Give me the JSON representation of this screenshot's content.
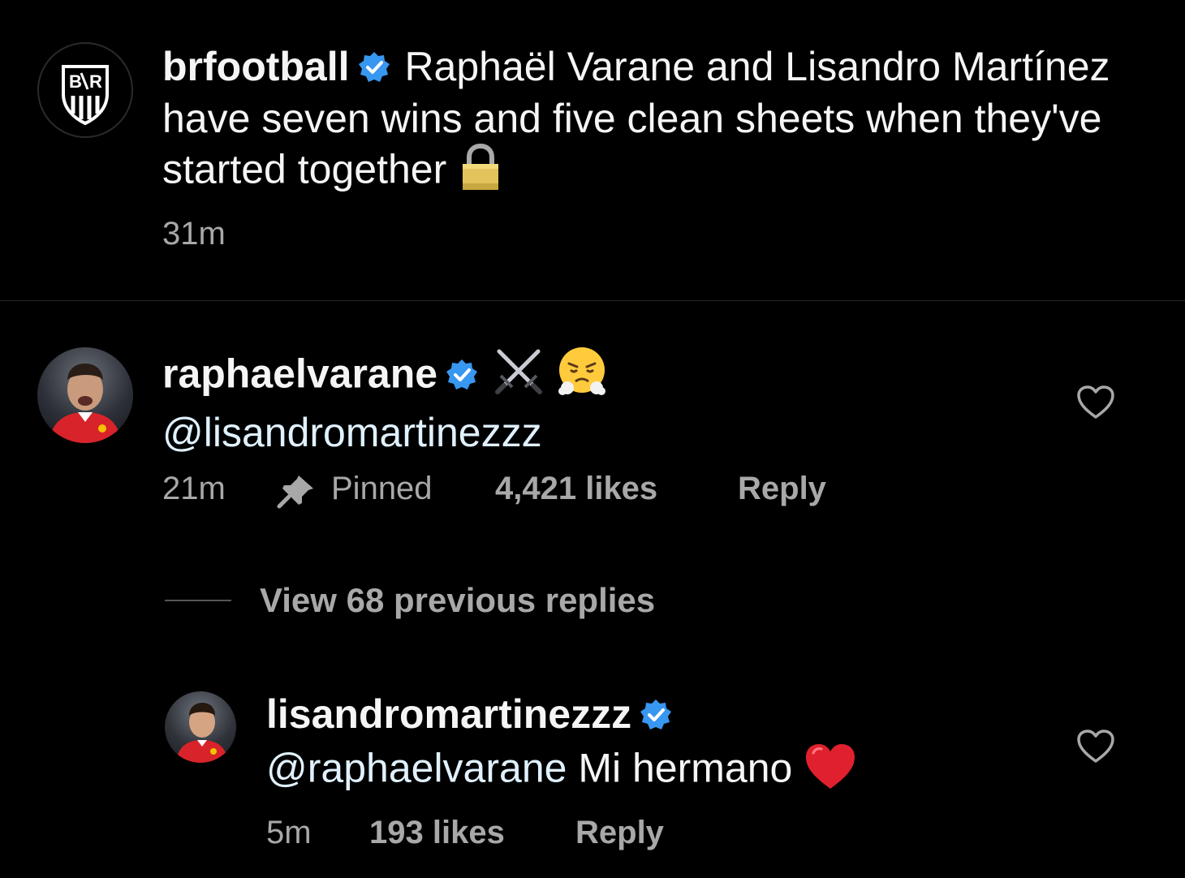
{
  "post": {
    "username": "brfootball",
    "avatar_icon": "bleacher-report-logo",
    "caption": "Raphaël Varane and Lisandro Martínez have seven wins and five clean sheets when they've started together",
    "caption_emoji": "lock-icon",
    "time": "31m"
  },
  "comments": [
    {
      "username": "raphaelvarane",
      "emoji": [
        "crossed-swords-icon",
        "face-with-steam-icon"
      ],
      "mention": "@lisandromartinezzz",
      "time": "21m",
      "pinned_label": "Pinned",
      "likes": "4,421 likes",
      "reply_label": "Reply"
    }
  ],
  "view_replies": "View 68 previous replies",
  "reply": {
    "username": "lisandromartinezzz",
    "mention": "@raphaelvarane",
    "text": "Mi hermano",
    "emoji": "red-heart-icon",
    "time": "5m",
    "likes": "193 likes",
    "reply_label": "Reply"
  },
  "colors": {
    "background": "#000000",
    "verified": "#3897f0",
    "secondary_text": "#a8a8a8",
    "heart": "#e0245e"
  }
}
